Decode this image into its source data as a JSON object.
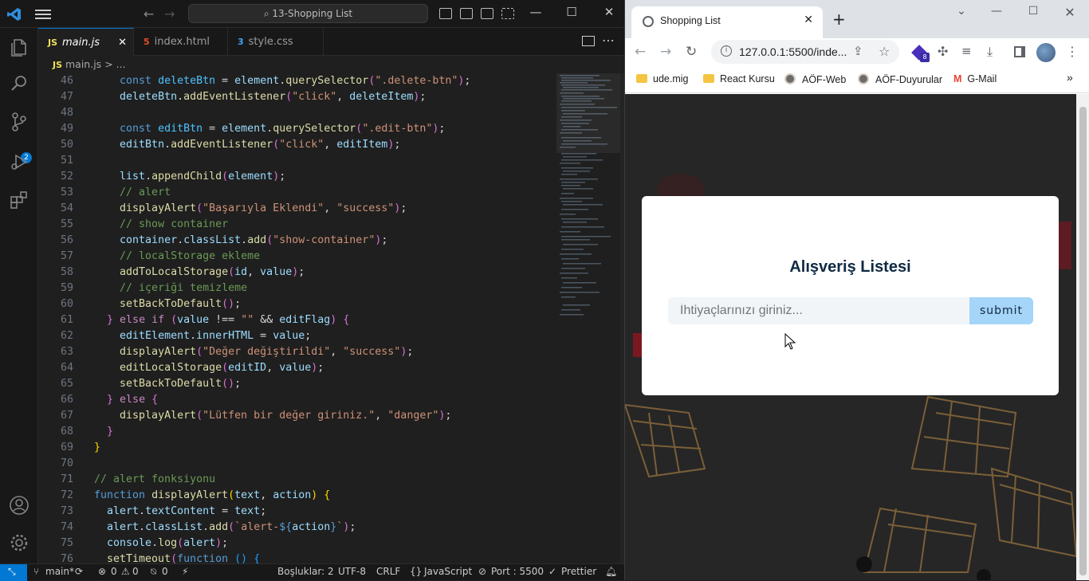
{
  "vscode": {
    "command_center": "13-Shopping List",
    "tabs": [
      {
        "icon": "JS",
        "label": "main.js",
        "color": "#f1e05a"
      },
      {
        "icon": "5",
        "label": "index.html",
        "color": "#e44d26"
      },
      {
        "icon": "3",
        "label": "style.css",
        "color": "#42a5f5"
      }
    ],
    "breadcrumb": {
      "icon": "JS",
      "file": "main.js",
      "sep": ">",
      "more": "..."
    },
    "line_numbers": [
      "46",
      "47",
      "48",
      "49",
      "50",
      "51",
      "52",
      "53",
      "54",
      "55",
      "56",
      "57",
      "58",
      "59",
      "60",
      "61",
      "62",
      "63",
      "64",
      "65",
      "66",
      "67",
      "68",
      "69",
      "70",
      "71",
      "72",
      "73",
      "74",
      "75",
      "76"
    ],
    "scm_badge": "2",
    "status": {
      "branch": "main*",
      "errors": "0",
      "warnings": "0",
      "ports": "0",
      "spaces": "Boşluklar: 2",
      "encoding": "UTF-8",
      "eol": "CRLF",
      "language": "JavaScript",
      "port": "Port : 5500",
      "prettier": "Prettier"
    }
  },
  "browser": {
    "tab_title": "Shopping List",
    "url": "127.0.0.1:5500/inde...",
    "extension_badge": "8",
    "bookmarks": [
      "ude.mig",
      "React Kursu",
      "AÖF-Web",
      "AÖF-Duyurular",
      "G-Mail"
    ],
    "page": {
      "title": "Alışveriş Listesi",
      "input_placeholder": "İhtiyaçlarınızı giriniz...",
      "submit_label": "submit"
    }
  }
}
